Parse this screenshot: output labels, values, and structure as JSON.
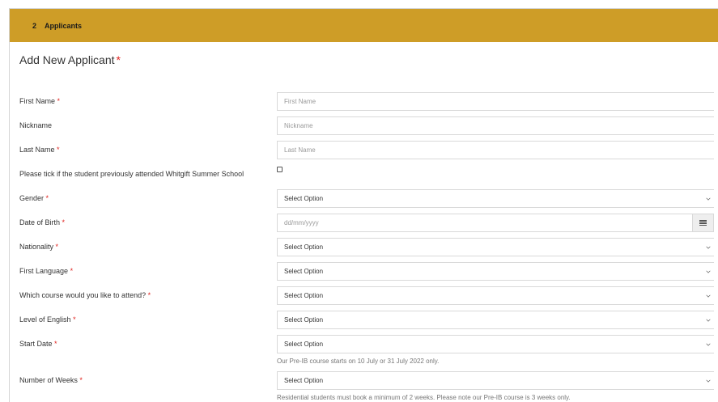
{
  "section": {
    "number": "2",
    "title": "Applicants"
  },
  "form": {
    "title": "Add New Applicant",
    "required_mark": "*"
  },
  "fields": {
    "first_name": {
      "label": "First Name",
      "placeholder": "First Name"
    },
    "nickname": {
      "label": "Nickname",
      "placeholder": "Nickname"
    },
    "last_name": {
      "label": "Last Name",
      "placeholder": "Last Name"
    },
    "previous_attendance": {
      "label": "Please tick if the student previously attended Whitgift Summer School",
      "checked": false
    },
    "gender": {
      "label": "Gender",
      "value": "Select Option"
    },
    "dob": {
      "label": "Date of Birth",
      "placeholder": "dd/mm/yyyy"
    },
    "nationality": {
      "label": "Nationality",
      "value": "Select Option"
    },
    "first_language": {
      "label": "First Language",
      "value": "Select Option"
    },
    "course": {
      "label": "Which course would you like to attend?",
      "value": "Select Option"
    },
    "english_level": {
      "label": "Level of English",
      "value": "Select Option"
    },
    "start_date": {
      "label": "Start Date",
      "value": "Select Option",
      "help": "Our Pre-IB course starts on 10 July or 31 July 2022 only."
    },
    "weeks": {
      "label": "Number of Weeks",
      "value": "Select Option",
      "help": "Residential students must book a minimum of 2 weeks. Please note our Pre-IB course is 3 weeks only."
    }
  }
}
